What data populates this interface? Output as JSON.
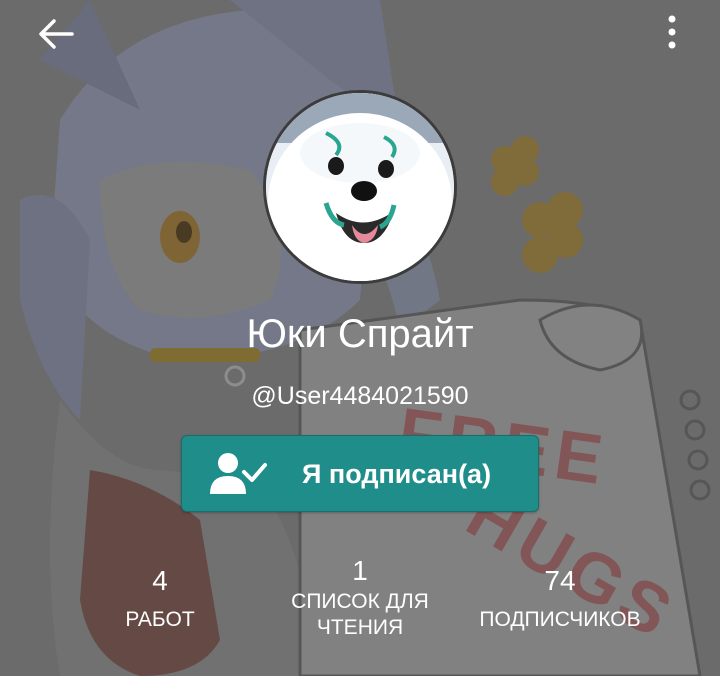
{
  "header": {
    "back_icon": "arrow-left-icon",
    "menu_icon": "more-vertical-icon"
  },
  "profile": {
    "name": "Юки Спрайт",
    "username": "@User4484021590"
  },
  "follow_button": {
    "label": "Я подписан(а)",
    "icon": "user-check-icon",
    "color": "#1f8e8a"
  },
  "stats": {
    "works": {
      "value": "4",
      "label": "РАБОТ"
    },
    "reading_list": {
      "value": "1",
      "label_line1": "СПИСОК ДЛЯ",
      "label_line2": "ЧТЕНИЯ"
    },
    "followers": {
      "value": "74",
      "label": "ПОДПИСЧИКОВ"
    }
  },
  "background": {
    "artwork_sign": "FREE HUGS"
  }
}
